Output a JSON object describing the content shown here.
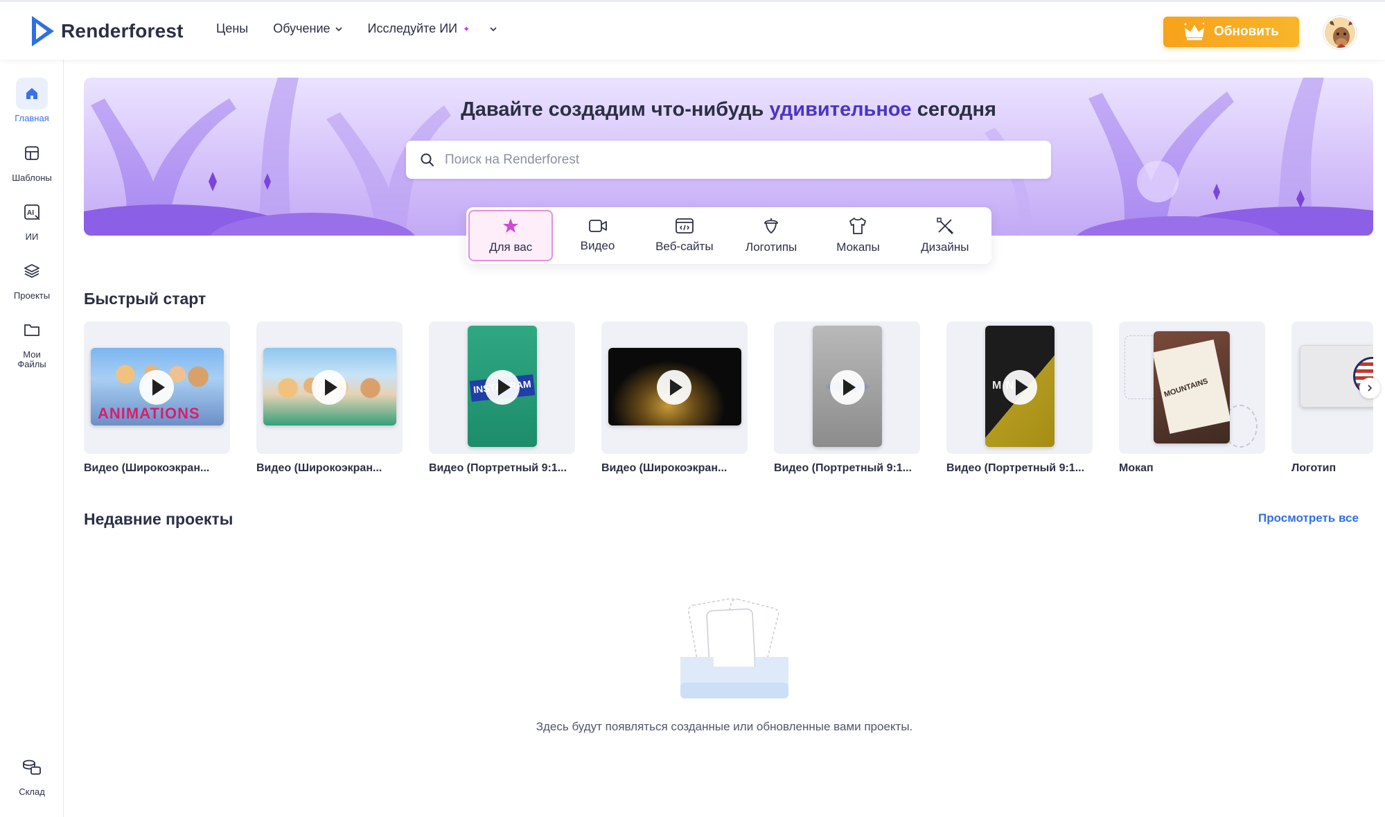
{
  "header": {
    "brand": "Renderforest",
    "nav": [
      {
        "label": "Цены",
        "has_dropdown": false
      },
      {
        "label": "Обучение",
        "has_dropdown": true
      },
      {
        "label": "Исследуйте ИИ",
        "has_dropdown": true
      }
    ],
    "upgrade_label": "Обновить"
  },
  "sidebar": {
    "items": [
      {
        "label": "Главная",
        "icon": "home-icon",
        "active": true
      },
      {
        "label": "Шаблоны",
        "icon": "templates-icon",
        "active": false
      },
      {
        "label": "ИИ",
        "icon": "ai-icon",
        "active": false
      },
      {
        "label": "Проекты",
        "icon": "layers-icon",
        "active": false
      },
      {
        "label": "Мои Файлы",
        "icon": "folder-icon",
        "active": false
      }
    ],
    "bottom_item": {
      "label": "Склад",
      "icon": "stock-icon"
    }
  },
  "hero": {
    "title_before": "Давайте создадим что-нибудь ",
    "title_accent": "удивительное",
    "title_after": " сегодня",
    "search_placeholder": "Поиск на Renderforest"
  },
  "categories": [
    {
      "label": "Для вас",
      "icon": "star-icon",
      "active": true
    },
    {
      "label": "Видео",
      "icon": "video-camera-icon",
      "active": false
    },
    {
      "label": "Веб-сайты",
      "icon": "website-icon",
      "active": false
    },
    {
      "label": "Логотипы",
      "icon": "acorn-logo-icon",
      "active": false
    },
    {
      "label": "Мокапы",
      "icon": "tshirt-icon",
      "active": false
    },
    {
      "label": "Дизайны",
      "icon": "design-tools-icon",
      "active": false
    }
  ],
  "quick_start": {
    "title": "Быстрый старт",
    "cards": [
      {
        "label": "Видео (Широкоэкран..."
      },
      {
        "label": "Видео (Широкоэкран..."
      },
      {
        "label": "Видео (Портретный 9:1..."
      },
      {
        "label": "Видео (Широкоэкран..."
      },
      {
        "label": "Видео (Портретный 9:1..."
      },
      {
        "label": "Видео (Портретный 9:1..."
      },
      {
        "label": "Мокап"
      },
      {
        "label": "Логотип"
      }
    ]
  },
  "recent": {
    "title": "Недавние проекты",
    "see_all": "Просмотреть все",
    "empty_text": "Здесь будут появляться созданные или обновленные вами проекты."
  },
  "colors": {
    "accent_blue": "#3a6ff0",
    "upgrade_orange": "#f7a21b",
    "hero_accent": "#4a33c9",
    "active_tab_border": "#e58ee0"
  }
}
